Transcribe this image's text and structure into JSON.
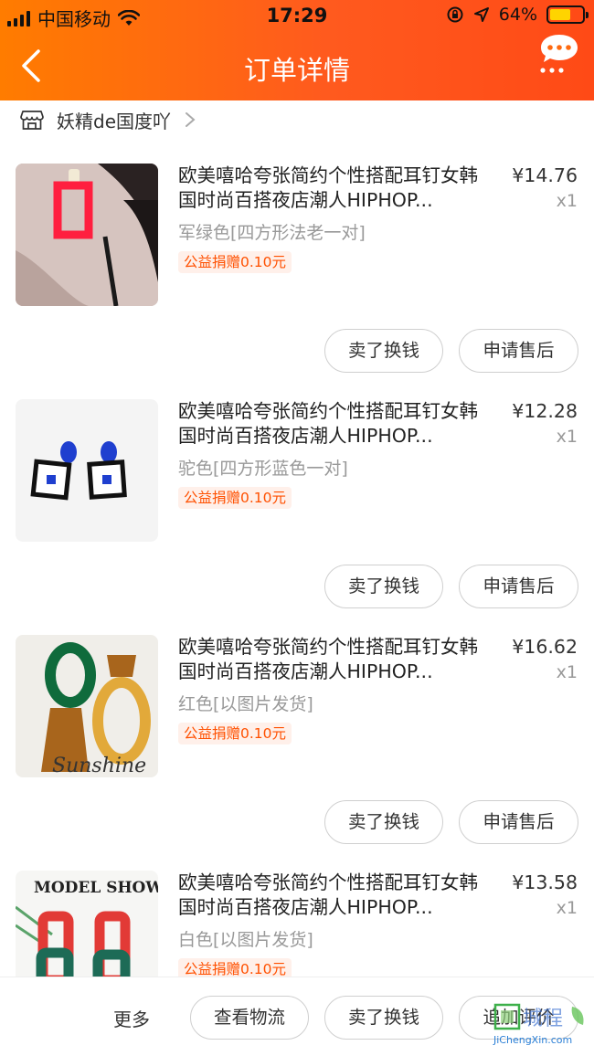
{
  "status_bar": {
    "carrier": "中国移动",
    "time": "17:29",
    "battery": "64%",
    "battery_level": 0.64
  },
  "nav": {
    "title": "订单详情",
    "back_icon": "chevron-left-icon",
    "more_icon": "chat-more-icon"
  },
  "store": {
    "name": "妖精de国度吖",
    "icon": "store-icon"
  },
  "items": [
    {
      "title": "欧美嘻哈夸张简约个性搭配耳钉女韩国时尚百搭夜店潮人HIPHOP...",
      "price": "¥14.76",
      "qty": "x1",
      "variant": "军绿色[四方形法老一对]",
      "charity": "公益捐赠0.10元",
      "sell_label": "卖了换钱",
      "aftersale_label": "申请售后"
    },
    {
      "title": "欧美嘻哈夸张简约个性搭配耳钉女韩国时尚百搭夜店潮人HIPHOP...",
      "price": "¥12.28",
      "qty": "x1",
      "variant": "驼色[四方形蓝色一对]",
      "charity": "公益捐赠0.10元",
      "sell_label": "卖了换钱",
      "aftersale_label": "申请售后"
    },
    {
      "title": "欧美嘻哈夸张简约个性搭配耳钉女韩国时尚百搭夜店潮人HIPHOP...",
      "price": "¥16.62",
      "qty": "x1",
      "variant": "红色[以图片发货]",
      "charity": "公益捐赠0.10元",
      "sell_label": "卖了换钱",
      "aftersale_label": "申请售后",
      "image_text": "Sunshine"
    },
    {
      "title": "欧美嘻哈夸张简约个性搭配耳钉女韩国时尚百搭夜店潮人HIPHOP...",
      "price": "¥13.58",
      "qty": "x1",
      "variant": "白色[以图片发货]",
      "charity": "公益捐赠0.10元",
      "image_text": "MODEL SHOW"
    }
  ],
  "bottom_bar": {
    "more_label": "更多",
    "logistics_label": "查看物流",
    "sell_label": "卖了换钱",
    "review_label": "追加评价"
  },
  "watermark": {
    "text": "城程",
    "url": "JiChengXin.com"
  },
  "colors": {
    "header_start": "#ff7c00",
    "header_end": "#ff4a16",
    "accent": "#ff5000"
  }
}
